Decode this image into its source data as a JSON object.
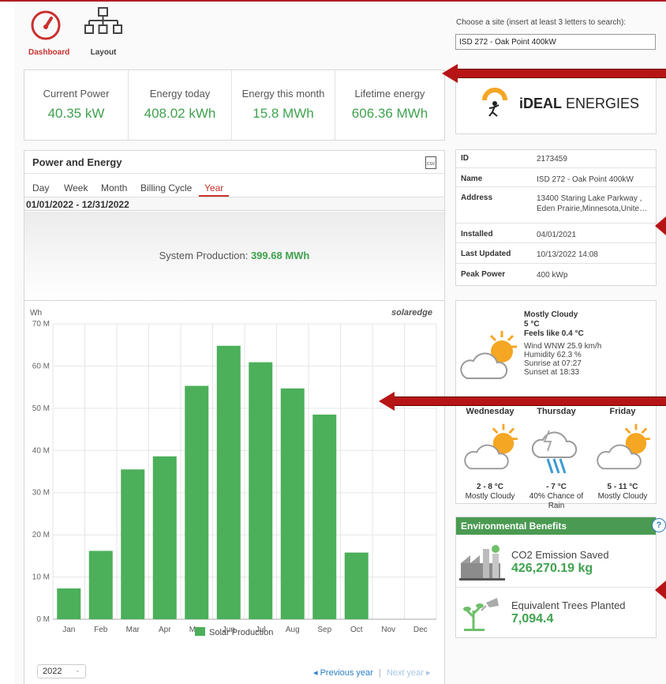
{
  "nav": {
    "dashboard_label": "Dashboard",
    "layout_label": "Layout"
  },
  "site_search": {
    "label": "Choose a site (insert at least 3 letters to search):",
    "value": "ISD 272 - Oak Point 400kW"
  },
  "kpis": [
    {
      "title": "Current Power",
      "value": "40.35 kW"
    },
    {
      "title": "Energy today",
      "value": "408.02 kWh"
    },
    {
      "title": "Energy this month",
      "value": "15.8 MWh"
    },
    {
      "title": "Lifetime energy",
      "value": "606.36 MWh"
    }
  ],
  "logo": {
    "brand_bold": "iDEAL",
    "brand_rest": " ENERGIES"
  },
  "power_energy": {
    "title": "Power and Energy",
    "csv_label": "CSV",
    "tabs": [
      "Day",
      "Week",
      "Month",
      "Billing Cycle",
      "Year"
    ],
    "active_tab": "Year",
    "date_range": "01/01/2022 - 12/31/2022",
    "production_label": "System Production:",
    "production_value": "399.68 MWh",
    "unit_label": "Wh",
    "brand": "solaredge",
    "year_select": "2022",
    "prev_label": "Previous year",
    "next_label": "Next year"
  },
  "chart_data": {
    "type": "bar",
    "categories": [
      "Jan",
      "Feb",
      "Mar",
      "Apr",
      "May",
      "Jun",
      "Jul",
      "Aug",
      "Sep",
      "Oct",
      "Nov",
      "Dec"
    ],
    "series": [
      {
        "name": "Solar Production",
        "values": [
          7.3,
          16.2,
          35.5,
          38.6,
          55.3,
          64.8,
          60.9,
          54.7,
          48.5,
          15.8,
          0,
          0
        ]
      }
    ],
    "ylabel": "Wh",
    "yticks": [
      "0 M",
      "10 M",
      "20 M",
      "30 M",
      "40 M",
      "50 M",
      "60 M",
      "70 M"
    ],
    "ylim": [
      0,
      70
    ],
    "grid": true,
    "legend": "bottom",
    "color": "#4caf5a"
  },
  "site_info": [
    {
      "key": "ID",
      "value": "2173459"
    },
    {
      "key": "Name",
      "value": "ISD 272 - Oak Point 400kW"
    },
    {
      "key": "Address",
      "value": "13400 Staring Lake Parkway ,",
      "value2": "Eden Prairie,Minnesota,Unite…"
    },
    {
      "key": "Installed",
      "value": "04/01/2021"
    },
    {
      "key": "Last Updated",
      "value": "10/13/2022 14:08"
    },
    {
      "key": "Peak Power",
      "value": "400 kWp"
    }
  ],
  "weather": {
    "condition": "Mostly Cloudy",
    "temp": "5 °C",
    "feels": "Feels like 0.4 °C",
    "wind": "Wind WNW 25.9 km/h",
    "humidity": "Humidity 62.3 %",
    "sunrise": "Sunrise at 07:27",
    "sunset": "Sunset at 18:33",
    "forecast": [
      {
        "day": "Wednesday",
        "temp": "2 - 8 °C",
        "desc": "Mostly Cloudy"
      },
      {
        "day": "Thursday",
        "temp": "- 7 °C",
        "desc": "40% Chance of Rain"
      },
      {
        "day": "Friday",
        "temp": "5 - 11 °C",
        "desc": "Mostly Cloudy"
      }
    ]
  },
  "env": {
    "title": "Environmental Benefits",
    "help": "?",
    "co2_label": "CO2 Emission Saved",
    "co2_value": "426,270.19 kg",
    "trees_label": "Equivalent Trees Planted",
    "trees_value": "7,094.4"
  },
  "colors": {
    "accent": "#c8312e",
    "green": "#3fa24e",
    "header_green": "#4a9a52",
    "arrow": "#b71416"
  }
}
